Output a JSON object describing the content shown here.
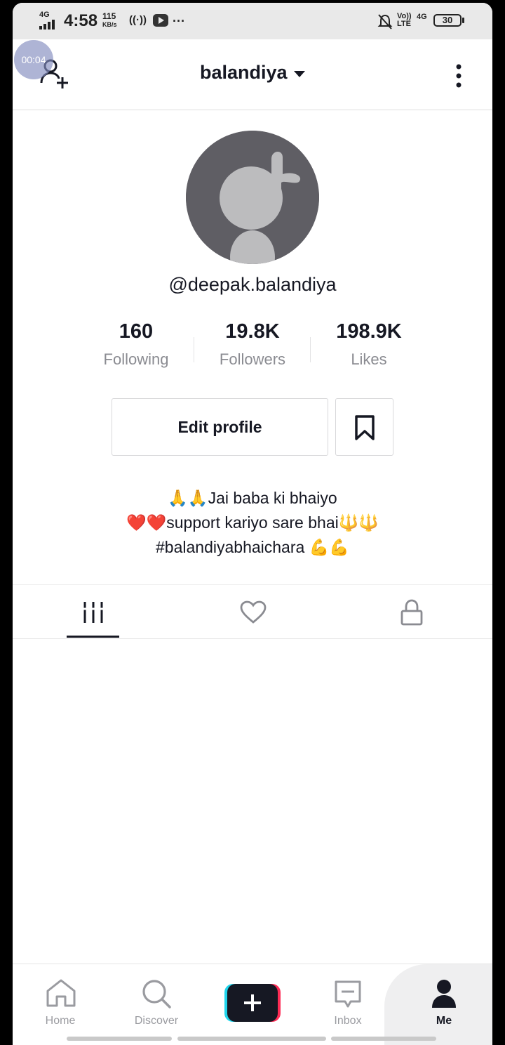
{
  "status_bar": {
    "network": "4G",
    "time": "4:58",
    "speed_value": "115",
    "speed_unit": "KB/s",
    "more": "···",
    "volte": "Vo)) LTE",
    "network2": "4G",
    "battery": "30"
  },
  "recording_timer": "00:04",
  "header": {
    "account_name": "balandiya"
  },
  "profile": {
    "username": "@deepak.balandiya",
    "stats": [
      {
        "value": "160",
        "label": "Following"
      },
      {
        "value": "19.8K",
        "label": "Followers"
      },
      {
        "value": "198.9K",
        "label": "Likes"
      }
    ],
    "edit_profile_label": "Edit profile",
    "bio_lines": [
      "🙏🙏Jai baba ki bhaiyo",
      "❤️❤️support kariyo sare bhai🔱🔱",
      "#balandiyabhaichara 💪💪"
    ]
  },
  "tabs": [
    {
      "icon": "videos-grid-icon",
      "active": true
    },
    {
      "icon": "heart-icon",
      "active": false
    },
    {
      "icon": "lock-icon",
      "active": false
    }
  ],
  "bottom_nav": [
    {
      "label": "Home",
      "icon": "home-icon"
    },
    {
      "label": "Discover",
      "icon": "search-icon"
    },
    {
      "label": "",
      "icon": "plus-icon"
    },
    {
      "label": "Inbox",
      "icon": "inbox-icon"
    },
    {
      "label": "Me",
      "icon": "person-icon",
      "active": true
    }
  ],
  "colors": {
    "text_primary": "#161823",
    "text_secondary": "#8a8b91",
    "accent_cyan": "#20d5ec",
    "accent_pink": "#fe2c55",
    "avatar_bg": "#5f5e64"
  }
}
